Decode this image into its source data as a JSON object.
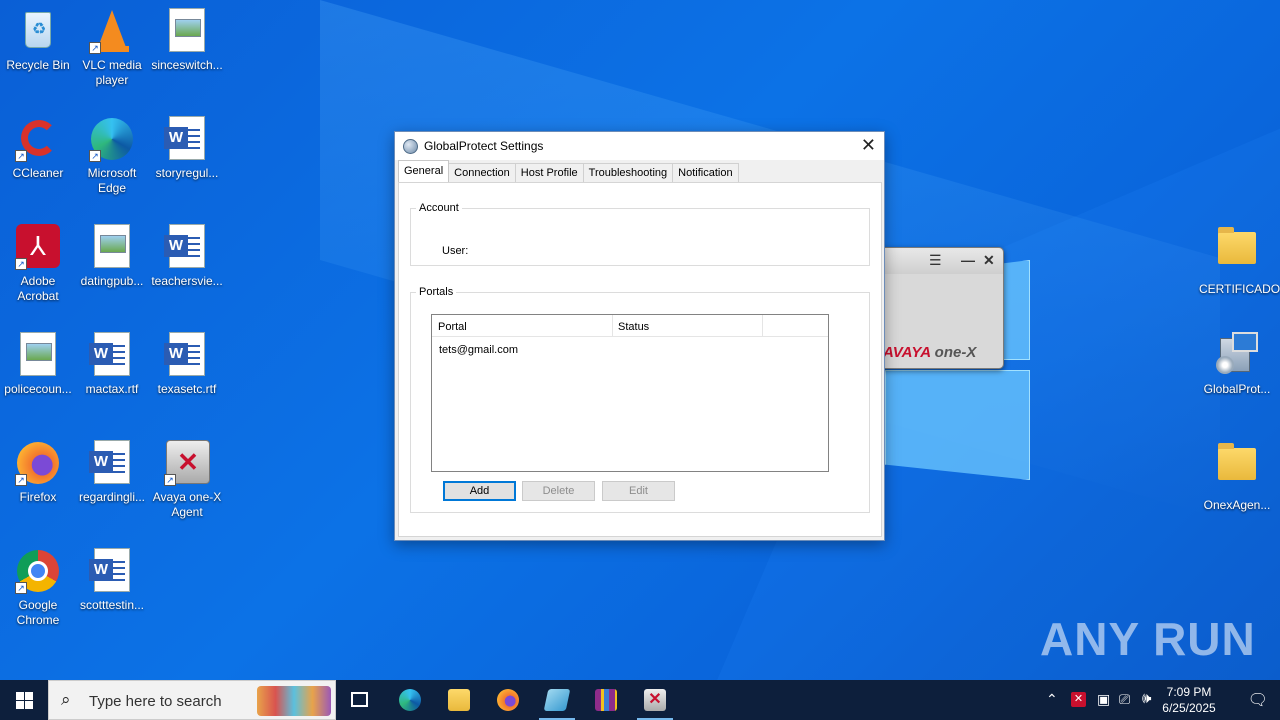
{
  "desktop": {
    "icons": [
      {
        "label": "Recycle Bin",
        "kind": "recycle"
      },
      {
        "label": "VLC media player",
        "kind": "vlc"
      },
      {
        "label": "sinceswitch...",
        "kind": "doc"
      },
      {
        "label": "CCleaner",
        "kind": "ccleaner"
      },
      {
        "label": "Microsoft Edge",
        "kind": "edge"
      },
      {
        "label": "storyregul...",
        "kind": "word"
      },
      {
        "label": "Adobe Acrobat",
        "kind": "acrobat"
      },
      {
        "label": "datingpub...",
        "kind": "doc"
      },
      {
        "label": "teachersvie...",
        "kind": "word"
      },
      {
        "label": "policecoun...",
        "kind": "doc"
      },
      {
        "label": "mactax.rtf",
        "kind": "word"
      },
      {
        "label": "texasetc.rtf",
        "kind": "word"
      },
      {
        "label": "Firefox",
        "kind": "firefox"
      },
      {
        "label": "regardingli...",
        "kind": "word"
      },
      {
        "label": "Avaya one-X Agent",
        "kind": "avaya"
      },
      {
        "label": "Google Chrome",
        "kind": "chrome"
      },
      {
        "label": "scotttestin...",
        "kind": "word"
      },
      {
        "label": "CERTIFICADO",
        "kind": "folder"
      },
      {
        "label": "GlobalProt...",
        "kind": "installer"
      },
      {
        "label": "OnexAgen...",
        "kind": "folder"
      }
    ]
  },
  "avaya_window": {
    "brand_left": "AVAYA",
    "brand_right": "one-X"
  },
  "dialog": {
    "title": "GlobalProtect Settings",
    "tabs": [
      "General",
      "Connection",
      "Host Profile",
      "Troubleshooting",
      "Notification"
    ],
    "active_tab": "General",
    "account_legend": "Account",
    "user_label": "User:",
    "portals_legend": "Portals",
    "columns": [
      "Portal",
      "Status"
    ],
    "rows": [
      {
        "portal": "tets@gmail.com",
        "status": ""
      }
    ],
    "buttons": {
      "add": "Add",
      "delete": "Delete",
      "edit": "Edit"
    }
  },
  "watermark": "ANY RUN",
  "taskbar": {
    "search_placeholder": "Type here to search",
    "time": "7:09 PM",
    "date": "6/25/2025"
  }
}
